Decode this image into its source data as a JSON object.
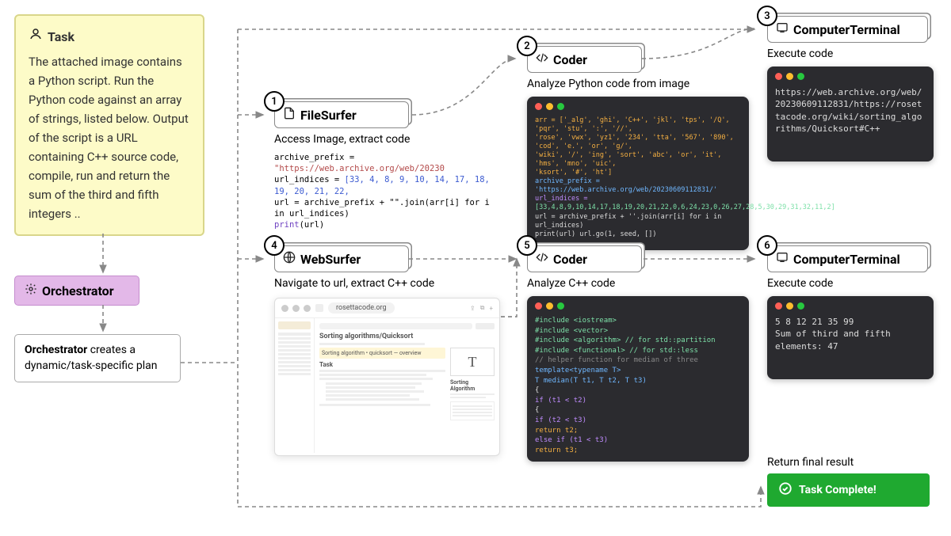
{
  "task": {
    "title": "Task",
    "body": "The attached image contains a Python script. Run the Python code against an array of strings, listed below. Output of the script is a URL containing C++ source code, compile, run and return the sum of the third and fifth integers .."
  },
  "orchestrator": {
    "label": "Orchestrator"
  },
  "plan": {
    "bold": "Orchestrator",
    "rest": " creates a dynamic/task-specific plan"
  },
  "steps": {
    "1": {
      "agent": "FileSurfer",
      "subtitle": "Access Image, extract code",
      "code": {
        "line1a": "archive_prefix = ",
        "line1b": "\"https://web.archive.org/web/20230",
        "line2a": "url_indices = ",
        "line2b": "[33, 4, 8, 9, 10, 14, 17, 18, 19, 20, 21, 22,",
        "line3": "url = archive_prefix + \"\".join(arr[i] for i in url_indices)",
        "line4a": "print",
        "line4b": "(url)"
      }
    },
    "2": {
      "agent": "Coder",
      "subtitle": "Analyze  Python code from image",
      "code": {
        "l1": "arr = ['_alg', 'ghi', 'C++', 'jkl', 'tps', '/Q', 'pqr', 'stu', ':', '//',",
        "l2": "'rose', 'vwx', 'yz1', '234', 'tta', '567', '890', 'cod', 'e.', 'or', 'g/',",
        "l3": "'wiki', '/', 'ing', 'sort', 'abc', 'or', 'it', 'hms', 'mno', 'uic',",
        "l4": "'ksort', '#', 'ht']",
        "l5": "archive_prefix = 'https://web.archive.org/web/20230609112831/'",
        "l6": "url_indices =",
        "l7": "[33,4,8,9,10,14,17,18,19,20,21,22,0,6,24,23,0,26,27,28,5,30,29,31,32,11,2]",
        "l8": "url = archive_prefix + ''.join(arr[i] for i in url_indices)",
        "l9": "print(url) url.go(1, seed, [])"
      }
    },
    "3": {
      "agent": "ComputerTerminal",
      "subtitle": "Execute code",
      "output": "https://web.archive.org/web/20230609112831/https://rosettacode.org/wiki/sorting_algorithms/Quicksort#C++"
    },
    "4": {
      "agent": "WebSurfer",
      "subtitle": "Navigate to url, extract C++ code",
      "url": "rosettacode.org",
      "page_title": "Sorting algorithms/Quicksort",
      "page_sub": "Sorting Algorithm",
      "page_task": "Task"
    },
    "5": {
      "agent": "Coder",
      "subtitle": "Analyze C++ code",
      "code": {
        "l1": "#include <iostream>",
        "l2": "#include <vector>",
        "l3": "#include <algorithm>  // for std::partition",
        "l4": "#include <functional> // for std::less",
        "l5": "",
        "l6": "// helper function for median of three",
        "l7": "template<typename T>",
        "l8": "T median(T t1, T t2, T t3)",
        "l9": "{",
        "l10": "  if (t1 < t2)",
        "l11": "  {",
        "l12": "    if (t2 < t3)",
        "l13": "      return t2;",
        "l14": "    else if (t1 < t3)",
        "l15": "      return t3;"
      }
    },
    "6": {
      "agent": "ComputerTerminal",
      "subtitle": "Execute code",
      "out1": "5 8 12 21 35 99",
      "out2": "Sum of third and fifth elements: 47"
    }
  },
  "final": {
    "label": "Return final result",
    "button": "Task Complete!"
  }
}
